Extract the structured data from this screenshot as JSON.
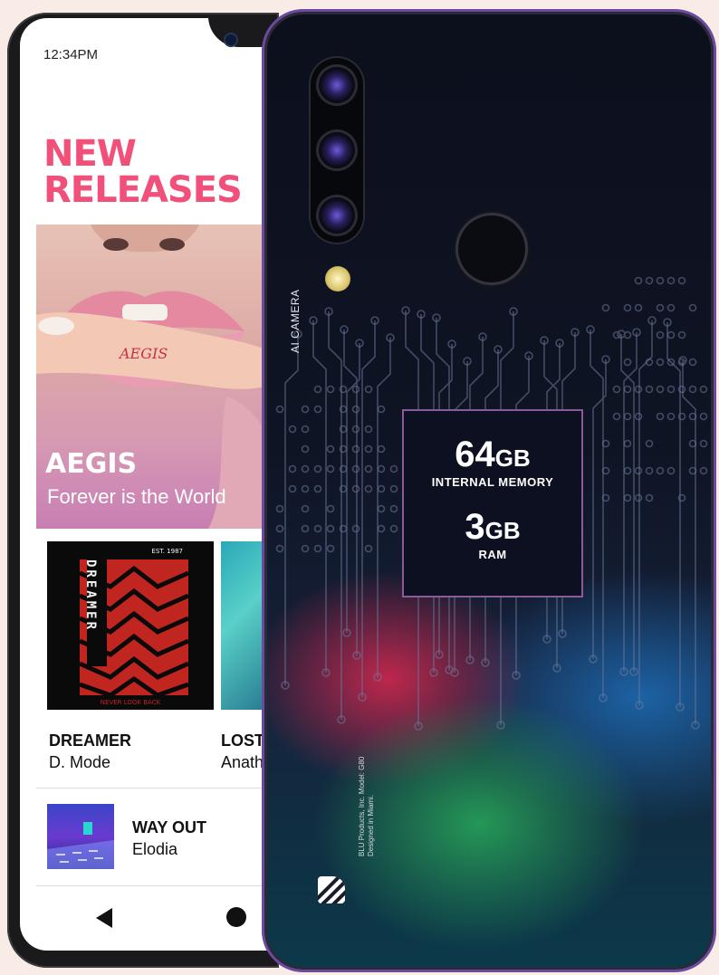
{
  "front_screen": {
    "status_time": "12:34PM",
    "section_title": "NEW RELEASES",
    "hero": {
      "finger_text": "AEGIS",
      "title": "AEGIS",
      "subtitle": "Forever is the World"
    },
    "albums": [
      {
        "title": "DREAMER",
        "artist": "D. Mode",
        "art_text": "DREAMER",
        "art_tag": "EST. 1987",
        "art_footer": "NEVER LOOK BACK"
      },
      {
        "title": "LOST",
        "artist": "Anath"
      }
    ],
    "featured": {
      "title": "WAY OUT",
      "artist": "Elodia"
    },
    "nav": {
      "back_icon": "back-triangle-icon",
      "home_icon": "home-circle-icon"
    }
  },
  "back_panel": {
    "camera_label": "AI CAMERA",
    "spec_memory_value": "64",
    "spec_memory_unit": "GB",
    "spec_memory_label": "INTERNAL MEMORY",
    "spec_ram_value": "3",
    "spec_ram_unit": "GB",
    "spec_ram_label": "RAM",
    "legal_line1": "BLU Products, Inc. Model: G80",
    "legal_line2": "Designed in Miami."
  },
  "colors": {
    "background": "#f9ebe6",
    "accent_pink": "#f0507a",
    "spec_border": "#8a5a9a"
  }
}
